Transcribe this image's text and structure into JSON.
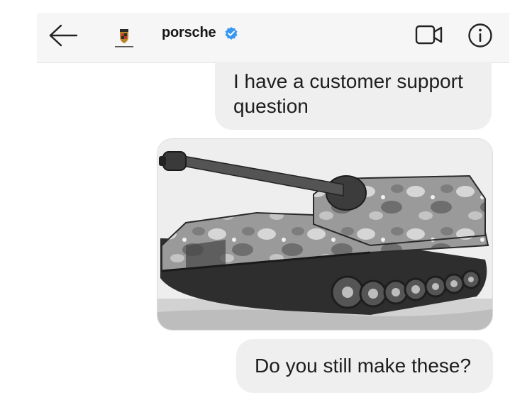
{
  "header": {
    "username": "porsche",
    "verified": true,
    "icons": {
      "back": "back-arrow-icon",
      "avatar": "porsche-crest-avatar",
      "verified": "verified-badge-icon",
      "video": "video-call-icon",
      "info": "info-icon"
    },
    "verified_color": "#3897f0"
  },
  "messages": [
    {
      "type": "text",
      "text": "I have a customer support question"
    },
    {
      "type": "image",
      "subject": "tank-photo"
    },
    {
      "type": "text",
      "text": "Do you still make these?"
    }
  ],
  "colors": {
    "header_bg": "#f6f6f6",
    "bubble_bg": "#efefef",
    "text": "#1b1b1b"
  }
}
